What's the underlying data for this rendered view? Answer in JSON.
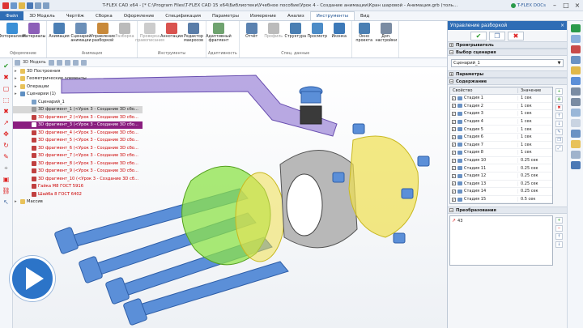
{
  "window": {
    "title": "T-FLEX CAD x64 - [* C:\\Program Files\\T-FLEX CAD 15 x64\\Библиотеки\\Учебное пособие\\Урок 4 - Создание анимации\\Кран шаровой - Анимация.grb (толь...",
    "docs_label": "T-FLEX DOCs"
  },
  "tabs": [
    "Файл",
    "3D Модель",
    "Чертёж",
    "Сборка",
    "Оформление",
    "Спецификация",
    "Параметры",
    "Измерение",
    "Анализ",
    "Инструменты",
    "Вид"
  ],
  "active_tab": "Инструменты",
  "ribbon": {
    "groups": [
      {
        "name": "Оформление",
        "buttons": [
          {
            "label": "Фотореализм",
            "color": "#3a8fd6"
          },
          {
            "label": "Материалы",
            "color": "#8c5fb8"
          }
        ]
      },
      {
        "name": "Анимация",
        "buttons": [
          {
            "label": "Анимация",
            "color": "#4b7fb5"
          },
          {
            "label": "Сценарий анимации",
            "color": "#6b8fb8"
          },
          {
            "label": "Управление разборкой",
            "color": "#c8893a"
          },
          {
            "label": "Разборка",
            "color": "#bbbbbb",
            "disabled": true
          }
        ]
      },
      {
        "name": "Инструменты",
        "buttons": [
          {
            "label": "Проверка правописания",
            "color": "#cccccc",
            "disabled": true
          },
          {
            "label": "Аннотации",
            "color": "#d9534f"
          },
          {
            "label": "Редактор макросов",
            "color": "#5a7da8"
          }
        ]
      },
      {
        "name": "Адаптивность",
        "buttons": [
          {
            "label": "Адаптивный фрагмент",
            "color": "#6fa36f"
          }
        ]
      },
      {
        "name": "Спец. данные",
        "buttons": [
          {
            "label": "Отчёт",
            "color": "#5b82b0"
          },
          {
            "label": "Профиль",
            "color": "#bbbbbb",
            "disabled": true
          },
          {
            "label": "Структура",
            "color": "#4a7fb3"
          },
          {
            "label": "Просмотр",
            "color": "#4c8cc7"
          },
          {
            "label": "Иконка",
            "color": "#3c79b8"
          }
        ]
      },
      {
        "name": "",
        "buttons": [
          {
            "label": "Окно проекта",
            "color": "#4a7fb3"
          },
          {
            "label": "Доп. настройки",
            "color": "#7a8ca3"
          }
        ]
      }
    ]
  },
  "subbar": {
    "label": "3D Модель"
  },
  "tree": [
    {
      "label": "3D Построения",
      "style": "normal",
      "indent": 0,
      "icon": "#e8c25a"
    },
    {
      "label": "Геометрические элементы",
      "style": "normal",
      "indent": 0,
      "icon": "#e8c25a"
    },
    {
      "label": "Операции",
      "style": "normal",
      "indent": 0,
      "icon": "#e8c25a"
    },
    {
      "label": "Сценарии (1)",
      "style": "normal",
      "indent": 0,
      "icon": "#5f8fc2"
    },
    {
      "label": "Сценарий_1",
      "style": "normal",
      "indent": 1,
      "icon": "#7aa0c8"
    },
    {
      "label": "3D фрагмент_1 (<Урок 3 - Создание 3D сбо...",
      "style": "hl-gray",
      "indent": 1,
      "icon": "#999999"
    },
    {
      "label": "3D фрагмент_2 (<Урок 3 - Создание 3D сбо...",
      "style": "red",
      "indent": 1,
      "icon": "#c04040"
    },
    {
      "label": "3D фрагмент_3 (<Урок 3 - Создание 3D сбо...",
      "style": "hl-purple",
      "indent": 1,
      "icon": "#ffffff"
    },
    {
      "label": "3D фрагмент_4 (<Урок 3 - Создание 3D сбо...",
      "style": "red",
      "indent": 1,
      "icon": "#c04040"
    },
    {
      "label": "3D фрагмент_5 (<Урок 3 - Создание 3D сбо...",
      "style": "red",
      "indent": 1,
      "icon": "#c04040"
    },
    {
      "label": "3D фрагмент_6 (<Урок 3 - Создание 3D сбо...",
      "style": "red",
      "indent": 1,
      "icon": "#c04040"
    },
    {
      "label": "3D фрагмент_7 (<Урок 3 - Создание 3D сбо...",
      "style": "red",
      "indent": 1,
      "icon": "#c04040"
    },
    {
      "label": "3D фрагмент_8 (<Урок 3 - Создание 3D сбо...",
      "style": "red",
      "indent": 1,
      "icon": "#c04040"
    },
    {
      "label": "3D фрагмент_9 (<Урок 3 - Создание 3D сбо...",
      "style": "red",
      "indent": 1,
      "icon": "#c04040"
    },
    {
      "label": "3D фрагмент_10 (<Урок 3 - Создание 3D сб...",
      "style": "red",
      "indent": 1,
      "icon": "#c04040"
    },
    {
      "label": "Гайка М8 ГОСТ 5916",
      "style": "red",
      "indent": 1,
      "icon": "#c04040"
    },
    {
      "label": "Шайба 8 ГОСТ 6402",
      "style": "red",
      "indent": 1,
      "icon": "#c04040"
    },
    {
      "label": "Массив",
      "style": "normal",
      "indent": 0,
      "icon": "#e8c25a"
    }
  ],
  "panel": {
    "title": "Управление разборкой",
    "sections": {
      "player": "Проигрыватель",
      "scenario": "Выбор сценария",
      "params": "Параметры",
      "content": "Содержание",
      "transforms": "Преобразования"
    },
    "scenario_value": "Сценарий_1",
    "columns": {
      "name": "Свойство",
      "value": "Значение"
    },
    "stages": [
      {
        "name": "Стадия 1",
        "value": "1 сек"
      },
      {
        "name": "Стадия 2",
        "value": "1 сек"
      },
      {
        "name": "Стадия 3",
        "value": "1 сек"
      },
      {
        "name": "Стадия 4",
        "value": "1 сек"
      },
      {
        "name": "Стадия 5",
        "value": "1 сек"
      },
      {
        "name": "Стадия 6",
        "value": "1 сек"
      },
      {
        "name": "Стадия 7",
        "value": "1 сек"
      },
      {
        "name": "Стадия 8",
        "value": "1 сек"
      },
      {
        "name": "Стадия 10",
        "value": "0.25 сек"
      },
      {
        "name": "Стадия 11",
        "value": "0.25 сек"
      },
      {
        "name": "Стадия 12",
        "value": "0.25 сек"
      },
      {
        "name": "Стадия 13",
        "value": "0.25 сек"
      },
      {
        "name": "Стадия 14",
        "value": "0.25 сек"
      },
      {
        "name": "Стадия 15",
        "value": "0.5 сек"
      }
    ],
    "transform_item": "43"
  },
  "colors": {
    "accent": "#2f6db5",
    "tree_selected": "#8a1d7f",
    "tree_missing": "#cc0000",
    "part_green": "#8de34a",
    "part_yellow": "#f0e050",
    "part_blue": "#5b8fd8"
  }
}
